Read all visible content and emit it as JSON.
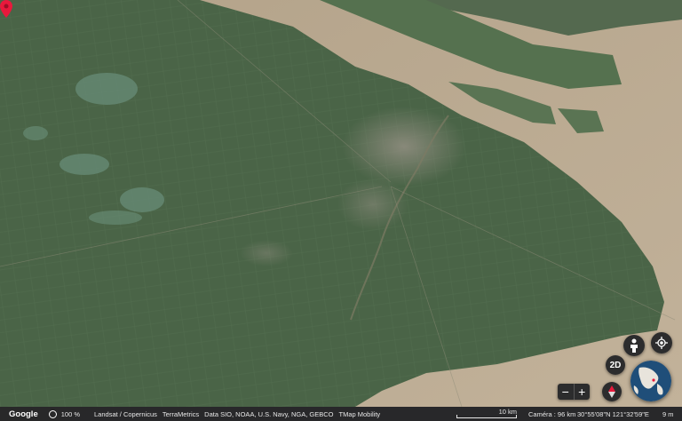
{
  "map": {
    "marker": "location-pin-icon",
    "colors": {
      "land": "#4a6447",
      "river": "#a89478",
      "sea": "#b9a78f",
      "urban": "#8a8878",
      "marker": "#e8193c"
    }
  },
  "controls": {
    "pegman_icon": "pegman-icon",
    "locate_icon": "my-location-icon",
    "toggle_2d_label": "2D",
    "zoom_out_label": "−",
    "zoom_in_label": "+",
    "compass_icon": "compass-icon",
    "globe_icon": "mini-globe-icon"
  },
  "footer": {
    "logo": "Google",
    "zoom_level": "100 %",
    "attributions": [
      "Landsat / Copernicus",
      "TerraMetrics",
      "Data SIO, NOAA, U.S. Navy, NGA, GEBCO",
      "TMap Mobility"
    ],
    "scale_label": "10 km",
    "camera": "Caméra : 96 km",
    "coordinates": "30°55'08\"N 121°32'59\"E",
    "elevation": "9 m"
  }
}
